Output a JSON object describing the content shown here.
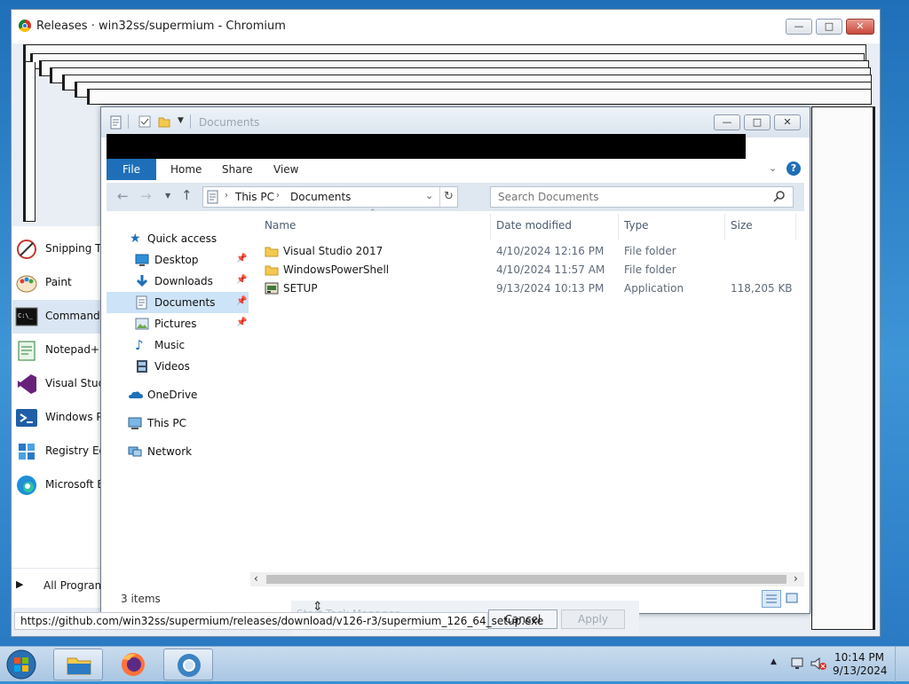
{
  "chromium": {
    "title": "Releases · win32ss/supermium - Chromium",
    "link_status": "https://github.com/win32ss/supermium/releases/download/v126-r3/supermium_126_64_setup.exe"
  },
  "start_menu": {
    "items": [
      {
        "label": "Snipping To"
      },
      {
        "label": "Paint"
      },
      {
        "label": "Command P"
      },
      {
        "label": "Notepad++"
      },
      {
        "label": "Visual Studi"
      },
      {
        "label": "Windows Po"
      },
      {
        "label": "Registry Edi"
      },
      {
        "label": "Microsoft E"
      }
    ],
    "all_programs": "All Program"
  },
  "explorer": {
    "title": "Documents",
    "ribbon_tabs": {
      "file": "File",
      "home": "Home",
      "share": "Share",
      "view": "View"
    },
    "address": {
      "root": "This PC",
      "current": "Documents"
    },
    "search_placeholder": "Search Documents",
    "nav": {
      "quick_access": "Quick access",
      "desktop": "Desktop",
      "downloads": "Downloads",
      "documents": "Documents",
      "pictures": "Pictures",
      "music": "Music",
      "videos": "Videos",
      "onedrive": "OneDrive",
      "this_pc": "This PC",
      "network": "Network"
    },
    "columns": {
      "name": "Name",
      "date": "Date modified",
      "type": "Type",
      "size": "Size"
    },
    "files": [
      {
        "name": "Visual Studio 2017",
        "date": "4/10/2024 12:16 PM",
        "type": "File folder",
        "size": ""
      },
      {
        "name": "WindowsPowerShell",
        "date": "4/10/2024 11:57 AM",
        "type": "File folder",
        "size": ""
      },
      {
        "name": "SETUP",
        "date": "9/13/2024 10:13 PM",
        "type": "Application",
        "size": "118,205 KB"
      }
    ],
    "status": "3 items"
  },
  "dialog": {
    "task_manager": "Start Task Manager",
    "cancel": "Cancel",
    "apply": "Apply"
  },
  "taskbar": {
    "time": "10:14 PM",
    "date": "9/13/2024"
  }
}
